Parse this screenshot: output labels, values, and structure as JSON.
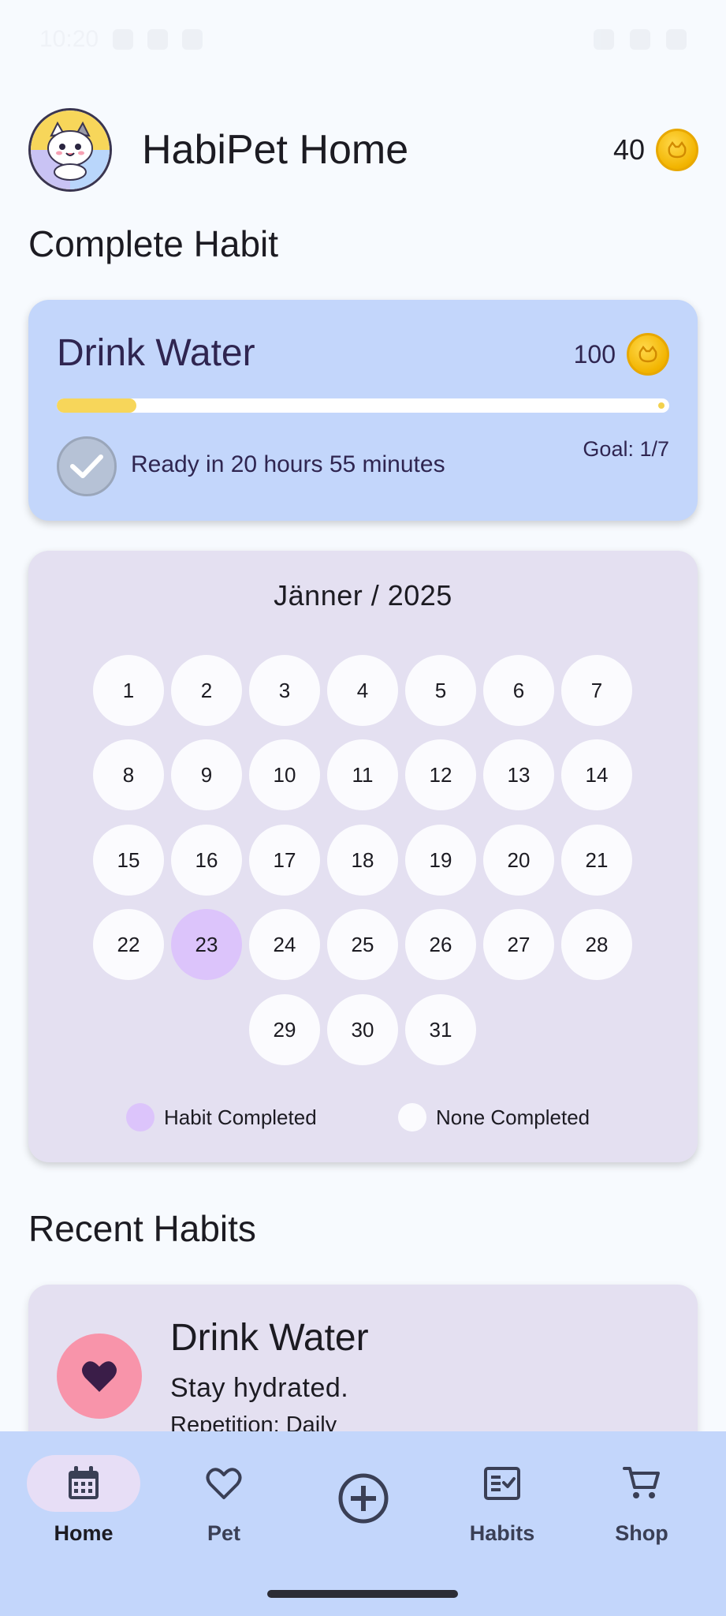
{
  "status_bar": {
    "time": "10:20"
  },
  "header": {
    "title": "HabiPet Home",
    "coins": "40",
    "avatar_icon": "cat-avatar-icon"
  },
  "complete_habit": {
    "section_title": "Complete Habit",
    "habit_name": "Drink Water",
    "reward": "100",
    "progress": 0.13,
    "ready_text": "Ready in 20 hours 55 minutes",
    "goal_text": "Goal: 1/7"
  },
  "calendar": {
    "month_label": "Jänner / 2025",
    "days": [
      "1",
      "2",
      "3",
      "4",
      "5",
      "6",
      "7",
      "8",
      "9",
      "10",
      "11",
      "12",
      "13",
      "14",
      "15",
      "16",
      "17",
      "18",
      "19",
      "20",
      "21",
      "22",
      "23",
      "24",
      "25",
      "26",
      "27",
      "28",
      "29",
      "30",
      "31"
    ],
    "completed_days": [
      "23"
    ],
    "legend": {
      "completed": "Habit Completed",
      "none": "None Completed"
    },
    "colors": {
      "completed": "#dcc4fb",
      "none": "#fbfbfe"
    }
  },
  "recent_habits": {
    "section_title": "Recent Habits",
    "items": [
      {
        "name": "Drink Water",
        "description": "Stay hydrated.",
        "repetition": "Repetition: Daily",
        "icon": "heart-icon"
      }
    ]
  },
  "bottom_nav": {
    "items": [
      {
        "label": "Home",
        "icon": "calendar-icon",
        "active": true
      },
      {
        "label": "Pet",
        "icon": "heart-outline-icon",
        "active": false
      },
      {
        "label": "",
        "icon": "add-circle-icon",
        "active": false
      },
      {
        "label": "Habits",
        "icon": "checklist-icon",
        "active": false
      },
      {
        "label": "Shop",
        "icon": "cart-icon",
        "active": false
      }
    ]
  },
  "colors": {
    "accent": "#c3d6fb",
    "card_lilac": "#e4e0f1",
    "coin": "#f2b400",
    "heart_bg": "#f894aa"
  }
}
